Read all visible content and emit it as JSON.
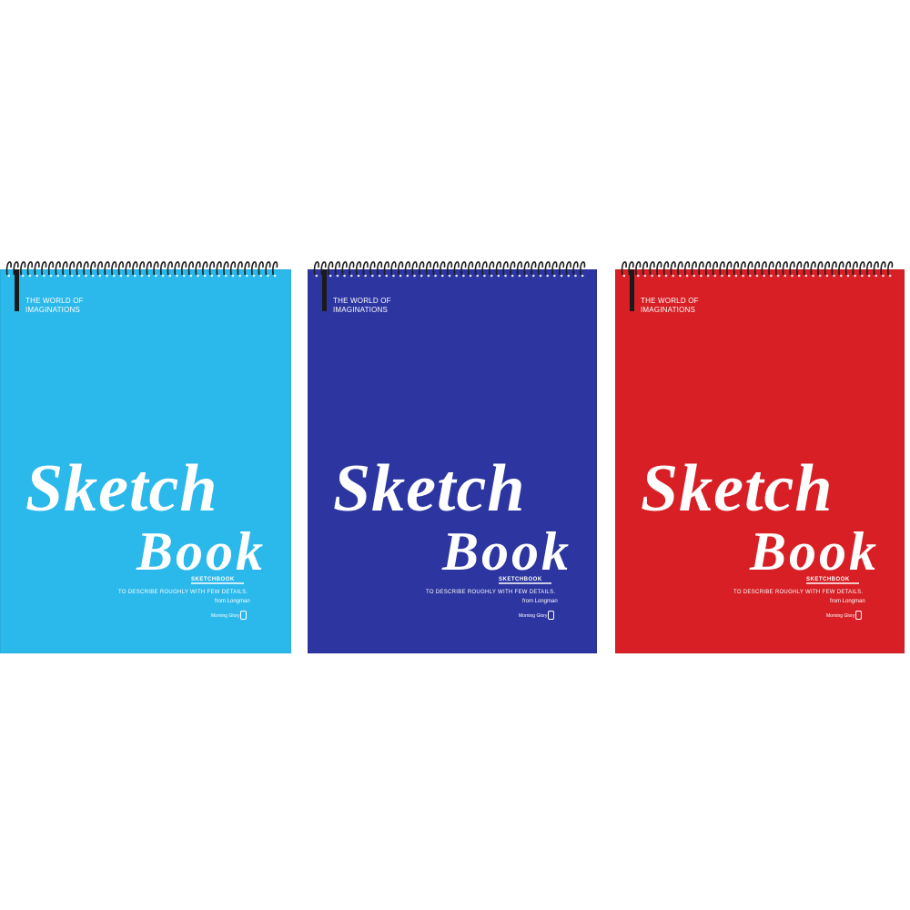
{
  "notebooks": [
    {
      "cover_color": "#2bb8ea",
      "tagline": "THE WORLD OF\nIMAGINATIONS",
      "title_line1": "Sketch",
      "title_line2": "Book",
      "subtitle": "SKETCHBOOK",
      "description": "TO DESCRIBE ROUGHLY WITH FEW DETAILS.",
      "source": "from Longman",
      "maker": "Morning Glory"
    },
    {
      "cover_color": "#2c35a0",
      "tagline": "THE WORLD OF\nIMAGINATIONS",
      "title_line1": "Sketch",
      "title_line2": "Book",
      "subtitle": "SKETCHBOOK",
      "description": "TO DESCRIBE ROUGHLY WITH FEW DETAILS.",
      "source": "from Longman",
      "maker": "Morning Glory"
    },
    {
      "cover_color": "#d71f25",
      "tagline": "THE WORLD OF\nIMAGINATIONS",
      "title_line1": "Sketch",
      "title_line2": "Book",
      "subtitle": "SKETCHBOOK",
      "description": "TO DESCRIBE ROUGHLY WITH FEW DETAILS.",
      "source": "from Longman",
      "maker": "Morning Glory"
    }
  ],
  "spiral_color": "#1e1e1e"
}
